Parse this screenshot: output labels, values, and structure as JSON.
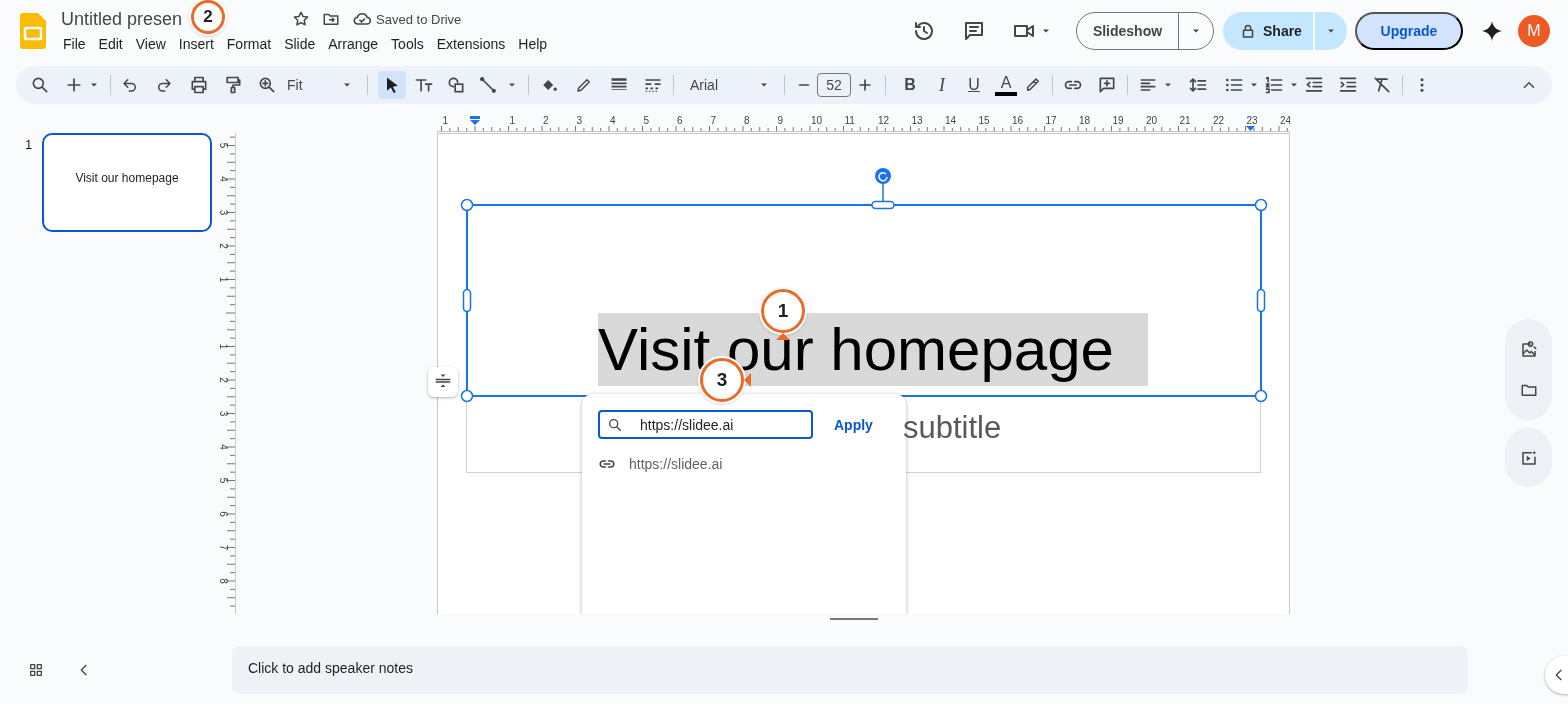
{
  "app": {
    "title": "Untitled presen",
    "save_status": "Saved to Drive",
    "menu": [
      "File",
      "Edit",
      "View",
      "Insert",
      "Format",
      "Slide",
      "Arrange",
      "Tools",
      "Extensions",
      "Help"
    ],
    "slideshow_button": "Slideshow",
    "share_button": "Share",
    "upgrade_button": "Upgrade",
    "avatar": "M"
  },
  "toolbar": {
    "zoom": "Fit",
    "tools": [
      {
        "kind": "select",
        "selected": true
      },
      {
        "kind": "textbox",
        "selected": false
      },
      {
        "kind": "shape",
        "selected": false
      },
      {
        "kind": "line",
        "selected": false
      }
    ],
    "font": "Arial",
    "font_size": "52",
    "text_style_buttons": [
      {
        "kind": "bold",
        "label": "B"
      },
      {
        "kind": "italic",
        "label": "I"
      },
      {
        "kind": "underline",
        "label": "U"
      },
      {
        "kind": "text_color",
        "label": "A"
      }
    ]
  },
  "filmstrip": [
    {
      "number": "1",
      "text": "Visit our homepage",
      "selected": true
    }
  ],
  "rulers": {
    "top": {
      "before": [
        "1"
      ],
      "after": [
        "1",
        "2",
        "3",
        "4",
        "5",
        "6",
        "7",
        "8",
        "9",
        "10",
        "11",
        "12",
        "13",
        "14",
        "15",
        "16",
        "17",
        "18",
        "19",
        "20",
        "21",
        "22",
        "23",
        "24"
      ]
    },
    "left": {
      "above": [
        "5",
        "4",
        "3",
        "2",
        "1"
      ],
      "below": [
        "1",
        "2",
        "3",
        "4",
        "5",
        "6",
        "7",
        "8"
      ]
    }
  },
  "slide": {
    "title": "Visit our homepage",
    "subtitle": "subtitle"
  },
  "link_popup": {
    "value": "https://slidee.ai",
    "apply": "Apply",
    "suggestions": [
      "https://slidee.ai"
    ]
  },
  "speaker_notes": {
    "placeholder": "Click to add speaker notes"
  },
  "callouts": [
    {
      "label": "1",
      "kind": "up"
    },
    {
      "label": "2",
      "kind": "down"
    },
    {
      "label": "3",
      "kind": "left"
    }
  ]
}
